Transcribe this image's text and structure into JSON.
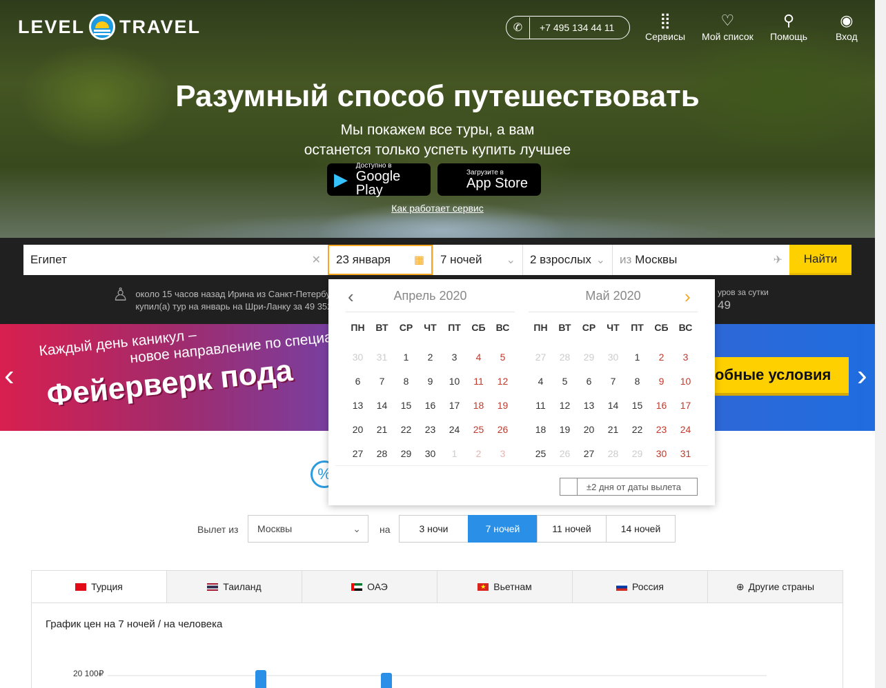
{
  "header": {
    "logo_left": "LEVEL",
    "logo_right": "TRAVEL",
    "phone": "+7 495 134 44 11",
    "nav": [
      {
        "label": "Сервисы",
        "icon": "grid-icon"
      },
      {
        "label": "Мой список",
        "icon": "heart-icon"
      },
      {
        "label": "Помощь",
        "icon": "bulb-icon"
      },
      {
        "label": "Вход",
        "icon": "user-icon"
      }
    ]
  },
  "hero": {
    "title": "Разумный способ путешествовать",
    "subtitle_line1": "Мы покажем все туры, а вам",
    "subtitle_line2": "останется только успеть купить лучшее",
    "google_small": "Доступно в",
    "google_big": "Google Play",
    "apple_small": "Загрузите в",
    "apple_big": "App Store",
    "how_link": "Как работает сервис"
  },
  "search": {
    "destination": "Египет",
    "date": "23 января",
    "nights": "7 ночей",
    "guests": "2 взрослых",
    "from_prefix": "из",
    "from_city": "Москвы",
    "find_button": "Найти",
    "ticker_line1": "около 15 часов назад Ирина из Санкт-Петербурга",
    "ticker_line2": "купил(а) тур на январь на Шри-Ланку за 49 352",
    "ticker_right1": "уров за сутки",
    "ticker_right2": "49"
  },
  "banner": {
    "line1": "Каждый день каникул –",
    "line2": "новое направление по специал",
    "big": "Фейерверк пода",
    "button": "обные условия"
  },
  "calendar": {
    "weekdays": [
      "ПН",
      "ВТ",
      "СР",
      "ЧТ",
      "ПТ",
      "СБ",
      "ВС"
    ],
    "month1": {
      "title": "Апрель 2020",
      "days": [
        "30",
        "31",
        "1",
        "2",
        "3",
        "4",
        "5",
        "6",
        "7",
        "8",
        "9",
        "10",
        "11",
        "12",
        "13",
        "14",
        "15",
        "16",
        "17",
        "18",
        "19",
        "20",
        "21",
        "22",
        "23",
        "24",
        "25",
        "26",
        "27",
        "28",
        "29",
        "30",
        "1",
        "2",
        "3"
      ],
      "other": [
        0,
        1,
        32,
        33,
        34
      ]
    },
    "month2": {
      "title": "Май 2020",
      "days": [
        "27",
        "28",
        "29",
        "30",
        "1",
        "2",
        "3",
        "4",
        "5",
        "6",
        "7",
        "8",
        "9",
        "10",
        "11",
        "12",
        "13",
        "14",
        "15",
        "16",
        "17",
        "18",
        "19",
        "20",
        "21",
        "22",
        "23",
        "24",
        "25",
        "26",
        "27",
        "28",
        "29",
        "30",
        "31"
      ],
      "other": [
        0,
        1,
        2,
        3,
        29,
        30,
        31,
        32,
        33,
        34
      ],
      "oth_inside": [
        29,
        31,
        32
      ]
    },
    "flex_label": "±2 дня от даты вылета"
  },
  "filters": {
    "from_label": "Вылет из",
    "from_value": "Москвы",
    "on_label": "на",
    "nights_options": [
      "3 ночи",
      "7 ночей",
      "11 ночей",
      "14 ночей"
    ],
    "selected_nights": 1
  },
  "countries": [
    {
      "label": "Турция",
      "flag": "#e30a17"
    },
    {
      "label": "Таиланд",
      "flag": "#2d2a4a"
    },
    {
      "label": "ОАЭ",
      "flag": "#00732f"
    },
    {
      "label": "Вьетнам",
      "flag": "#da251d"
    },
    {
      "label": "Россия",
      "flag": "#0039a6"
    },
    {
      "label": "Другие страны",
      "flag": ""
    }
  ],
  "price_chart": {
    "title": "График цен на 7 ночей / на человека",
    "y_tick": "20 100₽"
  },
  "colors": {
    "accent": "#2a8fe6",
    "button_yellow": "#ffd000",
    "weekend": "#c0392b"
  }
}
